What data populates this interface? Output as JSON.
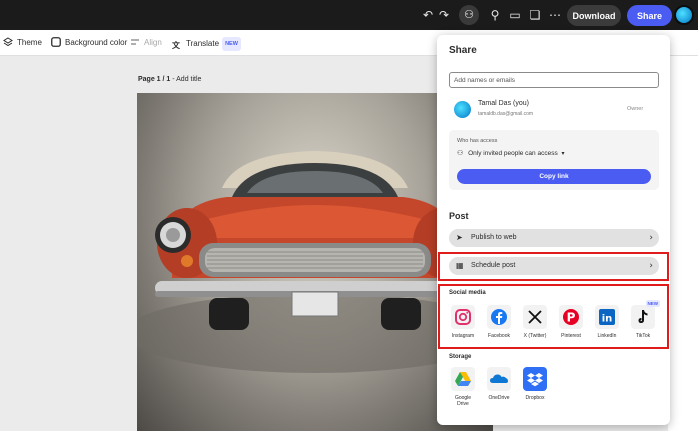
{
  "topbar": {
    "download_label": "Download",
    "share_label": "Share",
    "icons": [
      "undo-icon",
      "redo-icon",
      "user-settings-icon",
      "lightbulb-icon",
      "comment-icon",
      "chat-icon",
      "more-icon"
    ]
  },
  "toolbar": {
    "theme_label": "Theme",
    "background_label": "Background color",
    "align_label": "Align",
    "translate_label": "Translate",
    "translate_badge": "NEW"
  },
  "page": {
    "label_prefix": "Page 1 / 1",
    "label_suffix": " - Add title"
  },
  "share_panel": {
    "title": "Share",
    "input_placeholder": "Add names or emails",
    "owner": {
      "name": "Tamal Das (you)",
      "email": "tamaldb.das@gmail.com",
      "role": "Owner"
    },
    "access": {
      "label": "Who has access",
      "value": "Only invited people can access"
    },
    "copy_link_label": "Copy link",
    "post_title": "Post",
    "publish_label": "Publish to web",
    "schedule_label": "Schedule post",
    "social_title": "Social media",
    "social": [
      {
        "label": "Instagram",
        "icon": "instagram-icon",
        "color": "#e1306c"
      },
      {
        "label": "Facebook",
        "icon": "facebook-icon",
        "color": "#1877f2"
      },
      {
        "label": "X (Twitter)",
        "icon": "x-icon",
        "color": "#111111"
      },
      {
        "label": "Pinterest",
        "icon": "pinterest-icon",
        "color": "#e60023"
      },
      {
        "label": "LinkedIn",
        "icon": "linkedin-icon",
        "color": "#0a66c2"
      },
      {
        "label": "TikTok",
        "icon": "tiktok-icon",
        "color": "#111111",
        "badge": "NEW"
      }
    ],
    "storage_title": "Storage",
    "storage": [
      {
        "label": "Google Drive",
        "icon": "google-drive-icon"
      },
      {
        "label": "OneDrive",
        "icon": "onedrive-icon"
      },
      {
        "label": "Dropbox",
        "icon": "dropbox-icon"
      }
    ]
  },
  "colors": {
    "accent": "#4b5cf2",
    "highlight": "#e01b1b",
    "topbar": "#1b1b1b"
  }
}
